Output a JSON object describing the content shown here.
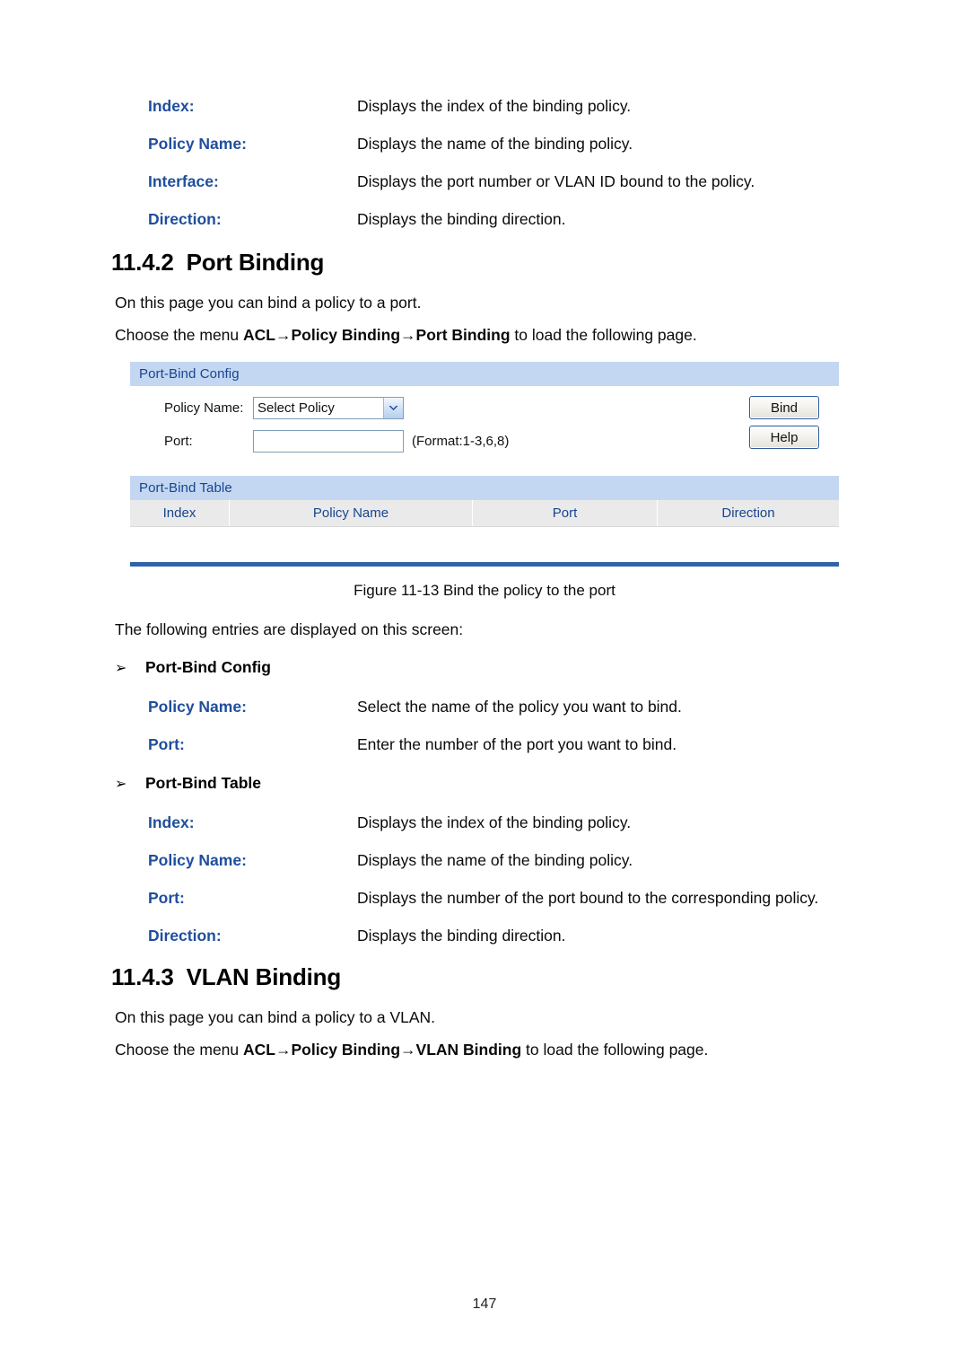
{
  "top_definitions": [
    {
      "term": "Index:",
      "desc": "Displays the index of the binding policy."
    },
    {
      "term": "Policy Name:",
      "desc": "Displays the name of the binding policy."
    },
    {
      "term": "Interface:",
      "desc": "Displays the port number or VLAN ID bound to the policy."
    },
    {
      "term": "Direction:",
      "desc": "Displays the binding direction."
    }
  ],
  "section_port_binding": {
    "number": "11.4.2",
    "title": "Port Binding",
    "intro": "On this page you can bind a policy to a port.",
    "menu_prefix": "Choose the menu ",
    "menu_path_1": "ACL",
    "menu_arrow_1": "→",
    "menu_path_2": "Policy Binding",
    "menu_arrow_2": "→",
    "menu_path_3": "Port Binding",
    "menu_suffix": " to load the following page."
  },
  "screenshot": {
    "config_panel": {
      "header": "Port-Bind Config",
      "policy_name_label": "Policy Name:",
      "policy_name_value": "Select Policy",
      "port_label": "Port:",
      "port_value": "",
      "port_format_hint": "(Format:1-3,6,8)",
      "bind_button": "Bind",
      "help_button": "Help"
    },
    "table_panel": {
      "header": "Port-Bind Table",
      "columns": [
        "Index",
        "Policy Name",
        "Port",
        "Direction"
      ],
      "rows": []
    },
    "colors": {
      "panel_header_bg": "#c3d7f2",
      "panel_header_text": "#17458f",
      "table_header_bg": "#eaeaea",
      "table_header_text": "#17458f",
      "separator_bar": "#2f62ab",
      "button_border": "#2f5c9e",
      "input_border": "#7f9db9"
    }
  },
  "figure_caption": "Figure 11-13 Bind the policy to the port",
  "entries_intro": "The following entries are displayed on this screen:",
  "bullets": {
    "marker": "➢",
    "port_bind_config": "Port-Bind Config",
    "port_bind_table": "Port-Bind Table"
  },
  "config_definitions": [
    {
      "term": "Policy Name:",
      "desc": "Select the name of the policy you want to bind."
    },
    {
      "term": "Port:",
      "desc": "Enter the number of the port you want to bind."
    }
  ],
  "table_definitions": [
    {
      "term": "Index:",
      "desc": "Displays the index of the binding policy."
    },
    {
      "term": "Policy Name:",
      "desc": "Displays the name of the binding policy."
    },
    {
      "term": "Port:",
      "desc": "Displays the number of the port bound to the corresponding policy."
    },
    {
      "term": "Direction:",
      "desc": "Displays the binding direction."
    }
  ],
  "section_vlan_binding": {
    "number": "11.4.3",
    "title": "VLAN Binding",
    "intro": "On this page you can bind a policy to a VLAN.",
    "menu_prefix": "Choose the menu ",
    "menu_path_1": "ACL",
    "menu_arrow_1": "→",
    "menu_path_2": "Policy Binding",
    "menu_arrow_2": "→",
    "menu_path_3": "VLAN Binding",
    "menu_suffix": " to load the following page."
  },
  "page_number": "147"
}
